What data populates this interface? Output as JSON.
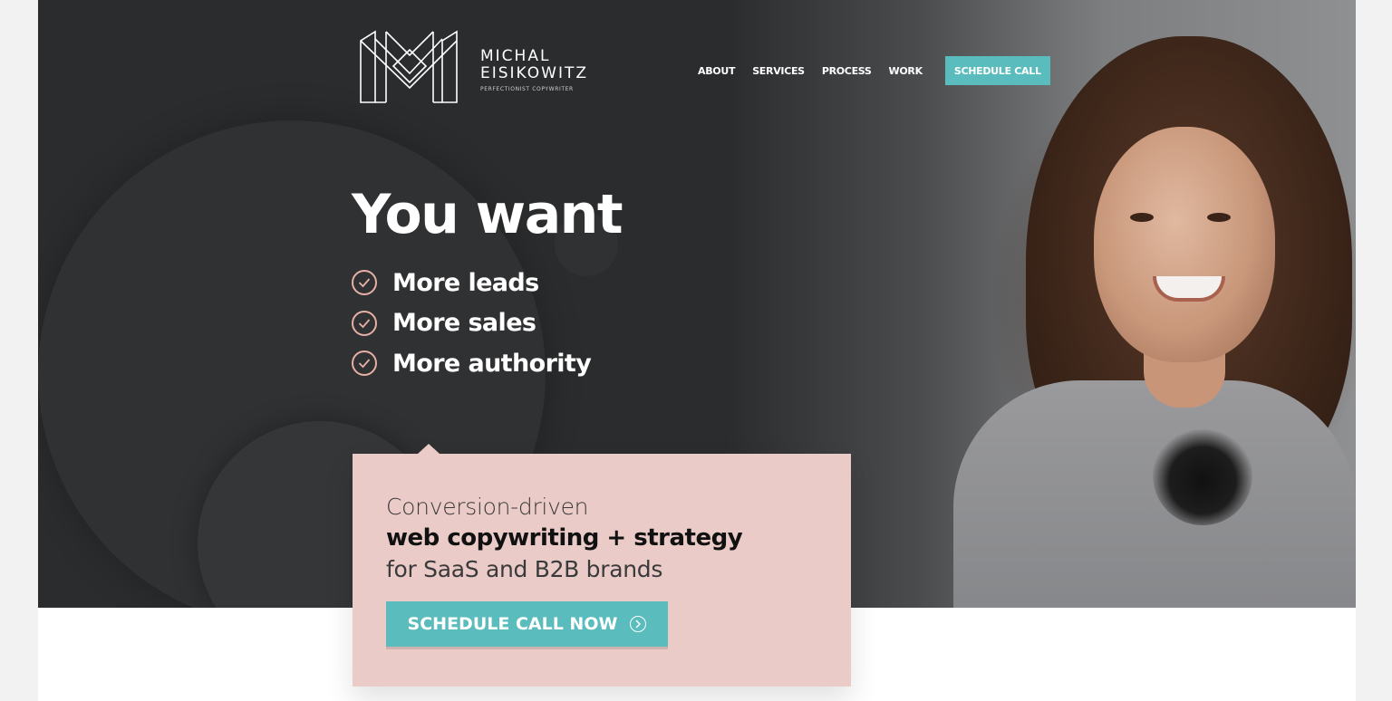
{
  "logo": {
    "name_line1": "MICHAL",
    "name_line2": "EISIKOWITZ",
    "tagline": "PERFECTIONIST COPYWRITER",
    "icon": "monogram-m-icon"
  },
  "nav": {
    "items": [
      {
        "label": "ABOUT"
      },
      {
        "label": "SERVICES"
      },
      {
        "label": "PROCESS"
      },
      {
        "label": "WORK"
      }
    ],
    "cta_label": "SCHEDULE CALL"
  },
  "hero": {
    "headline": "You want",
    "benefits": [
      {
        "label": "More leads",
        "icon": "check-circle-icon"
      },
      {
        "label": "More sales",
        "icon": "check-circle-icon"
      },
      {
        "label": "More authority",
        "icon": "check-circle-icon"
      }
    ]
  },
  "card": {
    "line1": "Conversion-driven",
    "line2": "web copywriting + strategy",
    "line3": "for SaaS and B2B brands",
    "cta_label": "SCHEDULE CALL NOW",
    "cta_icon": "chevron-right-circle-icon"
  },
  "colors": {
    "hero_bg": "#2b2c2d",
    "accent_teal": "#5bbcbd",
    "card_pink": "#ebcbc8",
    "check_pink": "#e7b0a6"
  }
}
